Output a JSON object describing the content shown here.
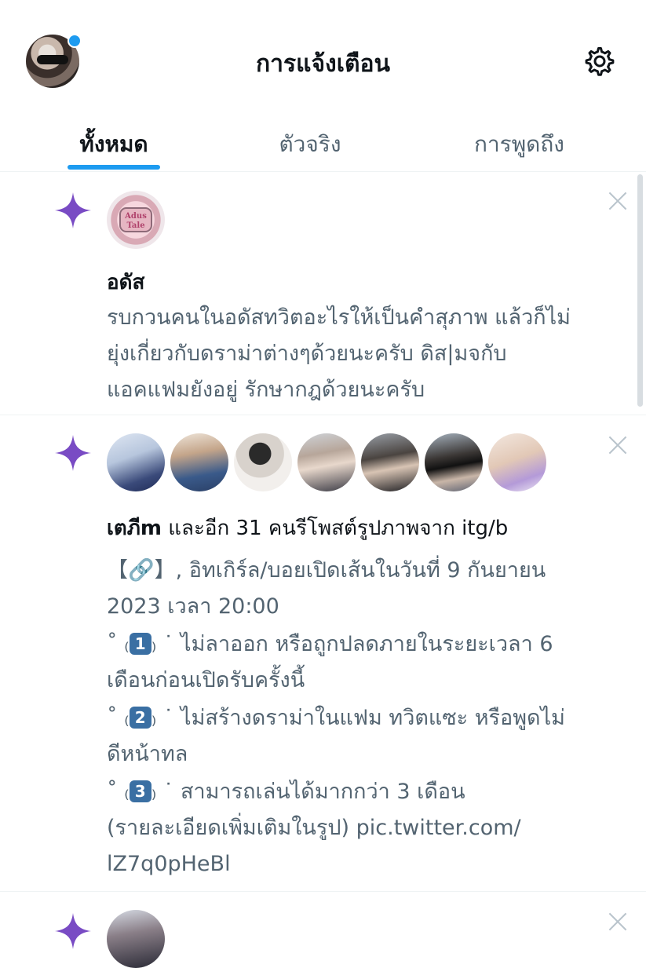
{
  "header": {
    "title": "การแจ้งเตือน",
    "settings_icon": "gear-icon",
    "has_unread": true
  },
  "tabs": [
    {
      "label": "ทั้งหมด",
      "active": true
    },
    {
      "label": "ตัวจริง",
      "active": false
    },
    {
      "label": "การพูดถึง",
      "active": false
    }
  ],
  "notifications": [
    {
      "icon": "sparkle-icon",
      "name": "อดัส",
      "avatar_text": "Adus Tale",
      "lines": [
        "รบกวนคนในอดัสทวิตอะไรให้เป็นคำสุภาพ แล้วก็ไม่",
        "ยุ่งเกี่ยวกับดราม่าต่างๆด้วยนะครับ ดิส|มจกับ",
        "แอคแฟมยังอยู่ รักษากฎด้วยนะครับ"
      ]
    },
    {
      "icon": "sparkle-icon",
      "avatar_count": 7,
      "headline_name": "เตภีm",
      "headline_rest": " และอีก 31 คนรีโพสต์รูปภาพจาก itg/b",
      "p1_line1": "【🔗】,   อิทเกิร์ล/บอยเปิดเส้นในวันที่ 9 กันยายน",
      "p1_line2": "2023 เวลา 20:00",
      "bullet_open": "˚ ₍",
      "bullet_close": "₎ ˙",
      "b1_key": "1",
      "b1_line1": "ไม่ลาออก หรือถูกปลดภายในระยะเวลา 6",
      "b1_line2": "เดือนก่อนเปิดรับครั้งนี้",
      "b2_key": "2",
      "b2_line1": "ไม่สร้างดราม่าในแฟม ทวิตแซะ หรือพูดไม่",
      "b2_line2": "ดีหน้าทล",
      "b3_key": "3",
      "b3_line1": "สามารถเล่นได้มากกว่า 3 เดือน",
      "b3_line2": "(รายละเอียดเพิ่มเติมในรูป) pic.twitter.com/",
      "b3_line3": "lZ7q0pHeBl"
    },
    {
      "icon": "sparkle-icon"
    }
  ],
  "colors": {
    "accent": "#1d9bf0",
    "sparkle": "#794bc4",
    "secondary_text": "#536471",
    "primary_text": "#0f1419",
    "divider": "#eff3f4"
  }
}
